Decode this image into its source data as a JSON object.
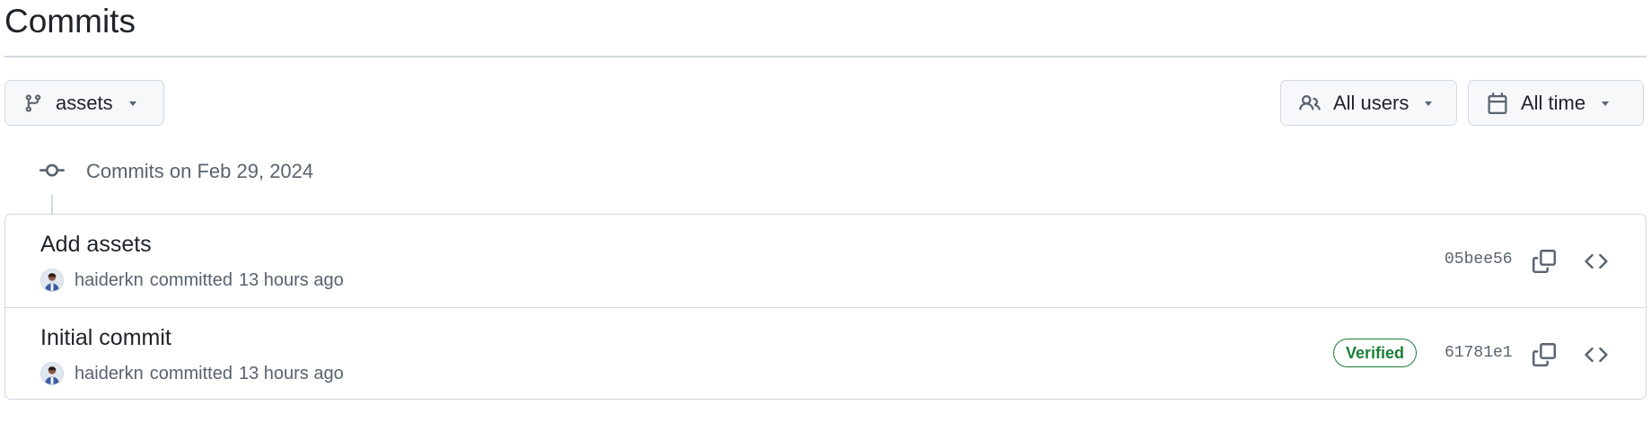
{
  "page": {
    "title": "Commits"
  },
  "filters": {
    "branch": {
      "label": "assets",
      "icon": "git-branch-icon"
    },
    "users": {
      "label": "All users",
      "icon": "people-icon"
    },
    "time": {
      "label": "All time",
      "icon": "calendar-icon"
    }
  },
  "group": {
    "heading": "Commits on Feb 29, 2024",
    "icon": "git-commit-icon"
  },
  "commits": [
    {
      "message": "Add assets",
      "author": "haiderkn",
      "verb": "committed",
      "when": "13 hours ago",
      "sha": "05bee56",
      "verified": null
    },
    {
      "message": "Initial commit",
      "author": "haiderkn",
      "verb": "committed",
      "when": "13 hours ago",
      "sha": "61781e1",
      "verified": "Verified"
    }
  ],
  "colors": {
    "border": "#d1d9e0",
    "muted": "#59636e",
    "verified": "#1a7f37",
    "button_bg": "#f6f8fa"
  }
}
